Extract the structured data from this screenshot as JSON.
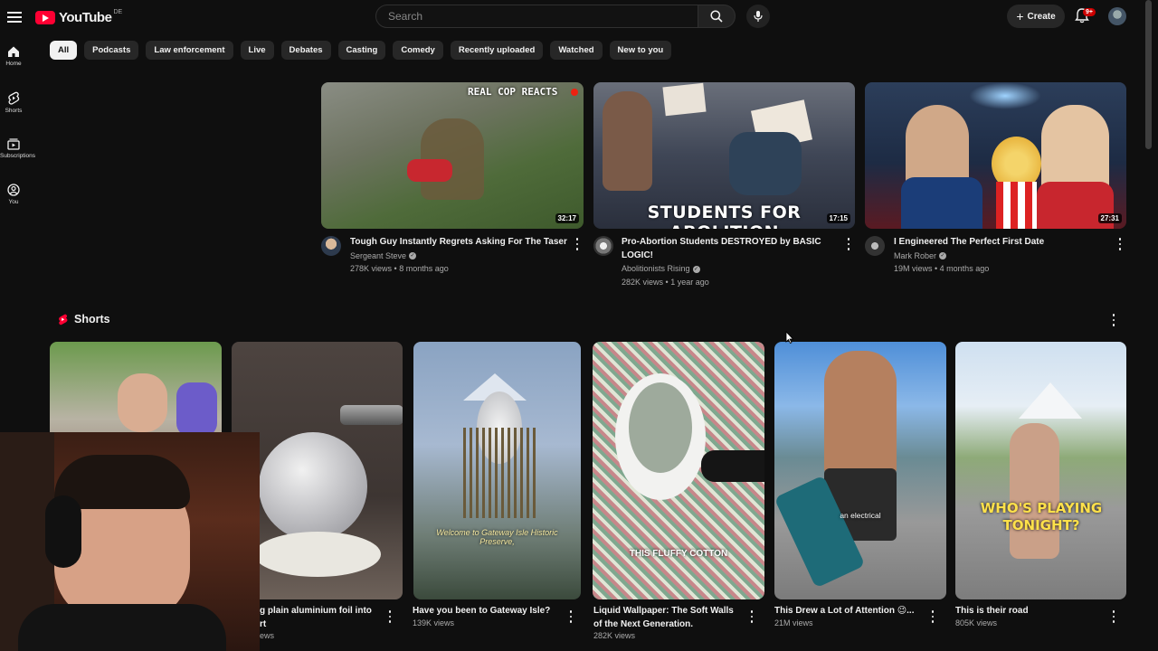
{
  "header": {
    "logo_text": "YouTube",
    "logo_country": "DE",
    "search_placeholder": "Search",
    "create_label": "Create",
    "notif_count": "9+"
  },
  "sidebar": {
    "items": [
      {
        "label": "Home",
        "icon": "home-icon"
      },
      {
        "label": "Shorts",
        "icon": "shorts-icon"
      },
      {
        "label": "Subscriptions",
        "icon": "subscriptions-icon"
      },
      {
        "label": "You",
        "icon": "you-icon"
      }
    ]
  },
  "chips": [
    "All",
    "Podcasts",
    "Law enforcement",
    "Live",
    "Debates",
    "Casting",
    "Comedy",
    "Recently uploaded",
    "Watched",
    "New to you"
  ],
  "videos": [
    {
      "title": "Tough Guy Instantly Regrets Asking For The Taser",
      "channel": "Sergeant Steve",
      "views": "278K views",
      "age": "8 months ago",
      "duration": "32:17",
      "overlay": "REAL COP REACTS"
    },
    {
      "title": "Pro-Abortion Students DESTROYED by BASIC LOGIC!",
      "channel": "Abolitionists Rising",
      "views": "282K views",
      "age": "1 year ago",
      "duration": "17:15",
      "overlay": "STUDENTS FOR ABOLITION"
    },
    {
      "title": "I Engineered The Perfect First Date",
      "channel": "Mark Rober",
      "views": "19M views",
      "age": "4 months ago",
      "duration": "27:31"
    }
  ],
  "shorts": {
    "heading": "Shorts",
    "items": [
      {
        "title": "",
        "views": ""
      },
      {
        "title": "g plain aluminium foil into",
        "title2": "rt",
        "views": "ews"
      },
      {
        "title": "Have you been to Gateway Isle?",
        "views": "139K views",
        "overlay": "Welcome to Gateway Isle Historic Preserve,"
      },
      {
        "title": "Liquid Wallpaper: The Soft Walls",
        "title2": "of the Next Generation.",
        "views": "282K views",
        "overlay": "THIS FLUFFY COTTON"
      },
      {
        "title": "This Drew a Lot of Attention 😉...",
        "views": "21M views",
        "overlay": "an electrical"
      },
      {
        "title": "This is their road",
        "views": "805K views",
        "overlay": "WHO'S PLAYING TONIGHT?"
      }
    ]
  },
  "colors": {
    "background": "#0f0f0f",
    "accent": "#ff0033",
    "chip_bg": "#272727",
    "chip_active_bg": "#f1f1f1",
    "meta_text": "#aaaaaa"
  }
}
